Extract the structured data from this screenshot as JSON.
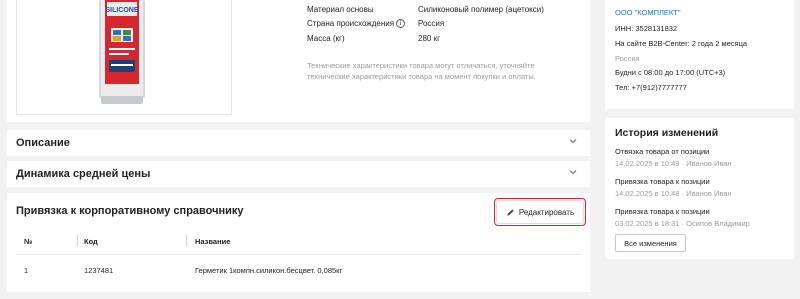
{
  "product": {
    "image_label": "SILICONE",
    "specs": [
      {
        "label": "Материал основы",
        "value": "Силиконовый полимер (ацетокси)"
      },
      {
        "label": "Страна происхождения",
        "value": "Россия",
        "info_icon": "info-icon"
      },
      {
        "label": "Масса (кг)",
        "value": "280 кг"
      }
    ],
    "note": "Технические характеристики товара могут отличаться, уточняйте технические характеристики товара на момент покупки и оплаты."
  },
  "sections": {
    "description": "Описание",
    "price_dynamics": "Динамика средней цены"
  },
  "corp_directory": {
    "title": "Привязка к корпоративному справочнику",
    "edit_label": "Редактировать",
    "columns": [
      "№",
      "Код",
      "Название"
    ],
    "rows": [
      {
        "num": "1",
        "code": "1237481",
        "name": "Герметик 1компн.силикон.бесцвет. 0,085кг"
      }
    ]
  },
  "supplier": {
    "name": "ООО \"КОМПЛЕКТ\"",
    "inn": "ИНН: 3528131832",
    "on_site": "На сайте B2B-Center: 2 года 2 месяца",
    "country": "Россия",
    "hours": "Будни с 08:00 до 17:00 (UTC+3)",
    "phone": "Тел: +7(912)7777777"
  },
  "history": {
    "title": "История изменений",
    "items": [
      {
        "title": "Отвязка товара от позиции",
        "meta": "14.02.2025 в 10:49 · Иванов Иван"
      },
      {
        "title": "Привязка товара к позиции",
        "meta": "14.02.2025 в 10:48 · Иванов Иван"
      },
      {
        "title": "Привязка товара к позиции",
        "meta": "03.02.2025 в 18:31 · Осипов Владимир"
      }
    ],
    "all_changes_label": "Все изменения"
  },
  "colors": {
    "link": "#1a73c9",
    "highlight": "#e0202a",
    "muted": "#9a9a9a",
    "background": "#f2f2f2"
  }
}
